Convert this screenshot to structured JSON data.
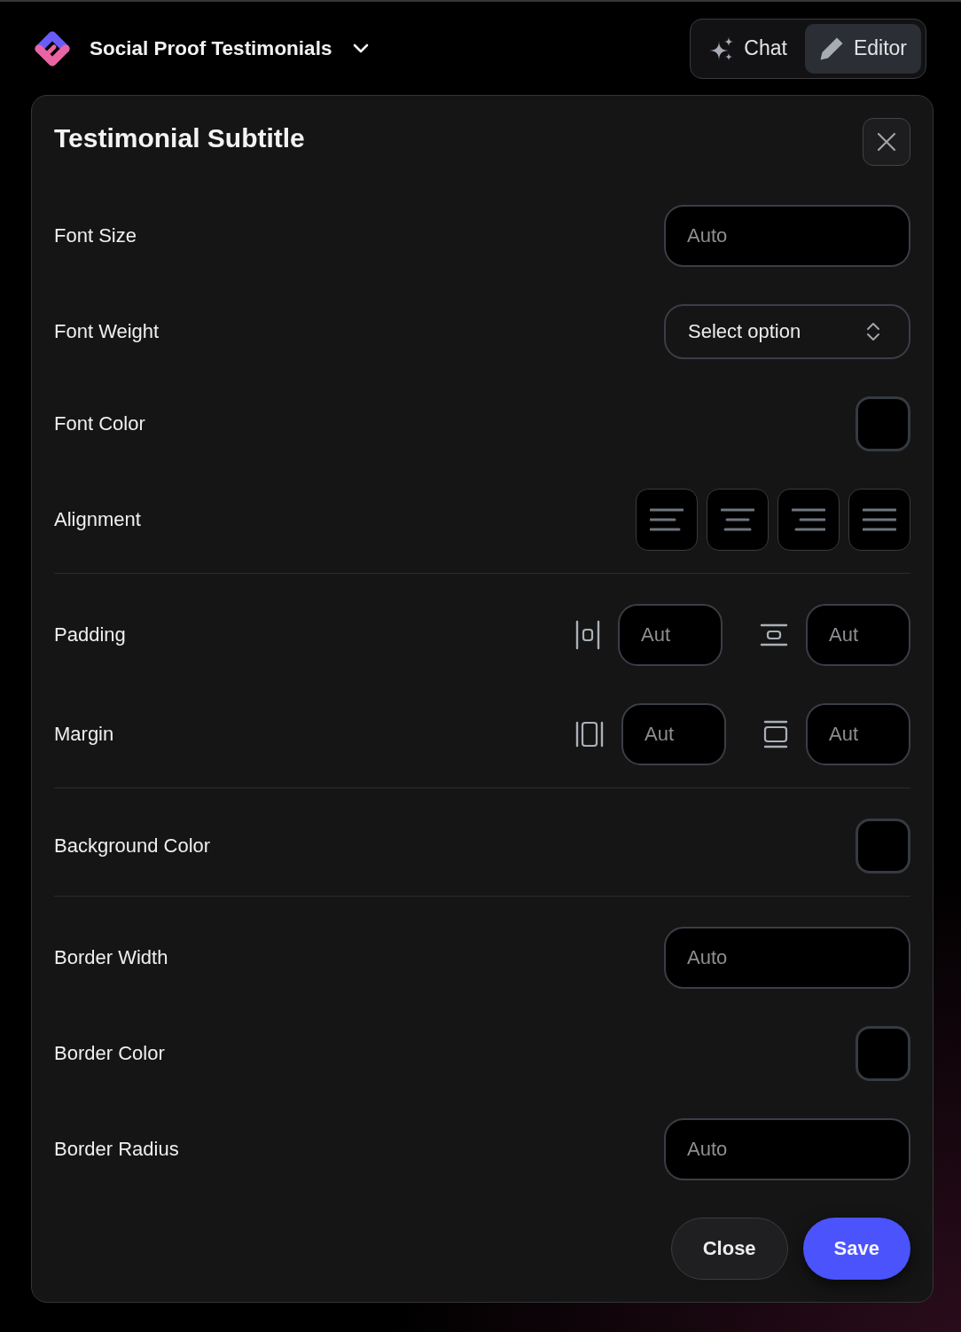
{
  "header": {
    "project": "Social Proof Testimonials",
    "modes": [
      {
        "kind": "chat",
        "label": "Chat",
        "selected": false
      },
      {
        "kind": "editor",
        "label": "Editor",
        "selected": true
      }
    ]
  },
  "panel": {
    "title": "Testimonial Subtitle",
    "sections": [
      {
        "rows": [
          {
            "kind": "input",
            "label": "Font Size",
            "placeholder": "Auto"
          },
          {
            "kind": "select",
            "label": "Font Weight",
            "value": "Select option"
          },
          {
            "kind": "color",
            "label": "Font Color",
            "color": "#000000"
          },
          {
            "kind": "alignment",
            "label": "Alignment",
            "options": [
              {
                "kind": "left"
              },
              {
                "kind": "center"
              },
              {
                "kind": "right"
              },
              {
                "kind": "justify"
              }
            ]
          }
        ]
      },
      {
        "rows": [
          {
            "kind": "spacing",
            "label": "Padding",
            "fields": [
              {
                "kind": "padding-x",
                "placeholder": "Aut"
              },
              {
                "kind": "padding-y",
                "placeholder": "Aut"
              }
            ]
          },
          {
            "kind": "spacing",
            "label": "Margin",
            "fields": [
              {
                "kind": "margin-x",
                "placeholder": "Aut"
              },
              {
                "kind": "margin-y",
                "placeholder": "Aut"
              }
            ]
          }
        ]
      },
      {
        "rows": [
          {
            "kind": "color",
            "label": "Background Color",
            "color": "#000000"
          }
        ]
      },
      {
        "rows": [
          {
            "kind": "input",
            "label": "Border Width",
            "placeholder": "Auto"
          },
          {
            "kind": "color",
            "label": "Border Color",
            "color": "#000000"
          },
          {
            "kind": "input",
            "label": "Border Radius",
            "placeholder": "Auto"
          }
        ]
      }
    ],
    "buttons": [
      {
        "kind": "secondary",
        "label": "Close"
      },
      {
        "kind": "primary",
        "label": "Save"
      }
    ]
  }
}
